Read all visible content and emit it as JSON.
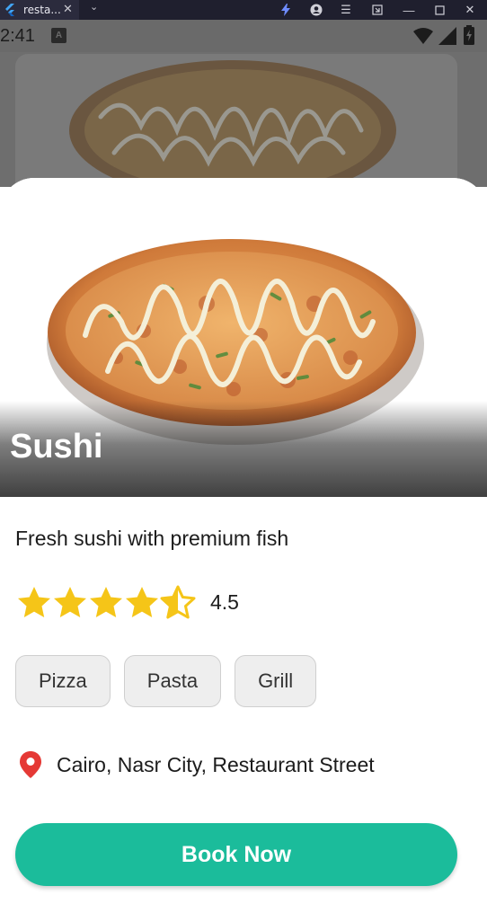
{
  "window": {
    "tab_title": "resta...",
    "tab_close_icon": "close-icon",
    "tab_menu_icon": "chevron-down-icon"
  },
  "status_bar": {
    "time": "2:41",
    "badge": "A"
  },
  "restaurant": {
    "name": "Sushi",
    "description": "Fresh sushi with premium fish",
    "rating": 4.5,
    "rating_label": "4.5",
    "rating_max": 5,
    "categories": [
      "Pizza",
      "Pasta",
      "Grill"
    ],
    "location": "Cairo, Nasr City, Restaurant Street"
  },
  "actions": {
    "book_label": "Book Now"
  },
  "colors": {
    "accent": "#1bbc9b",
    "star": "#f5c518",
    "location_pin": "#e53935"
  }
}
